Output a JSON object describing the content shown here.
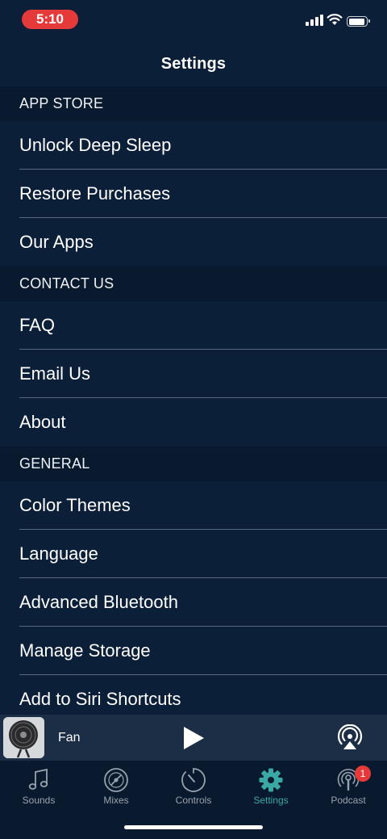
{
  "status_bar": {
    "time": "5:10"
  },
  "nav": {
    "title": "Settings"
  },
  "sections": [
    {
      "header": "APP STORE",
      "items": [
        "Unlock Deep Sleep",
        "Restore Purchases",
        "Our Apps"
      ]
    },
    {
      "header": "CONTACT US",
      "items": [
        "FAQ",
        "Email Us",
        "About"
      ]
    },
    {
      "header": "GENERAL",
      "items": [
        "Color Themes",
        "Language",
        "Advanced Bluetooth",
        "Manage Storage",
        "Add to Siri Shortcuts"
      ]
    }
  ],
  "mini_player": {
    "track": "Fan",
    "icons": [
      "fan-thumbnail",
      "play-icon",
      "airplay-icon"
    ]
  },
  "tabs": [
    {
      "label": "Sounds",
      "icon": "music-note-icon",
      "active": false
    },
    {
      "label": "Mixes",
      "icon": "disc-icon",
      "active": false
    },
    {
      "label": "Controls",
      "icon": "timer-icon",
      "active": false
    },
    {
      "label": "Settings",
      "icon": "gear-icon",
      "active": true
    },
    {
      "label": "Podcast",
      "icon": "podcast-icon",
      "active": false,
      "badge": "1"
    }
  ],
  "colors": {
    "background": "#0c1f38",
    "section_header": "#0a1a2e",
    "accent": "#3aa8a3",
    "badge": "#e5393a"
  }
}
